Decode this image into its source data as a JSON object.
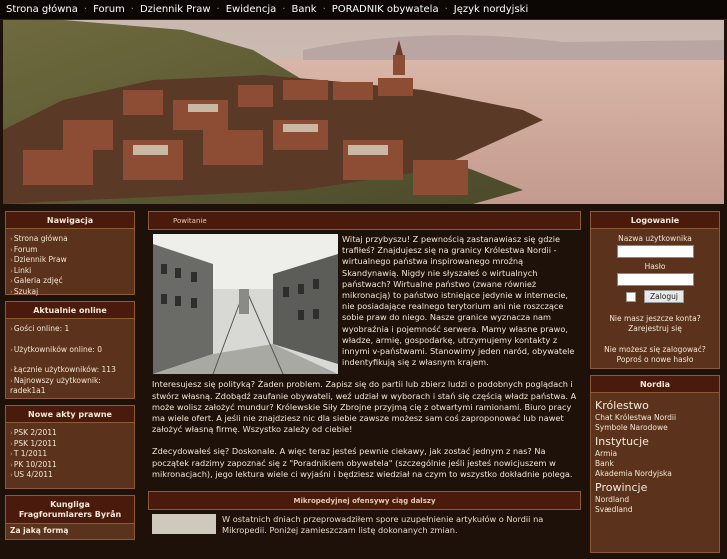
{
  "topnav": [
    "Strona główna",
    "Forum",
    "Dziennik Praw",
    "Ewidencja",
    "Bank",
    "PORADNIK obywatela",
    "Język nordyjski"
  ],
  "left": {
    "nav": {
      "title": "Nawigacja",
      "items": [
        "Strona główna",
        "Forum",
        "Dziennik Praw",
        "Linki",
        "Galeria zdjęć",
        "Szukaj"
      ]
    },
    "online": {
      "title": "Aktualnie online",
      "guests": "Gości online: 1",
      "users": "Użytkowników online: 0",
      "total": "Łącznie użytkowników: 113",
      "newest_label": "Najnowszy użytkownik:",
      "newest_user": "radek1a1"
    },
    "acts": {
      "title": "Nowe akty prawne",
      "items": [
        "PSK 2/2011",
        "PSK 1/2011",
        "T 1/2011",
        "PK 10/2011",
        "US 4/2011"
      ]
    },
    "kungliga": {
      "title_line1": "Kungliga",
      "title_line2": "Fragforumlarers Byrån",
      "body": "Za jaką formą"
    }
  },
  "center": {
    "welcome_title": "Powitanie",
    "paragraph1": "Witaj przybyszu! Z pewnością zastanawiasz się gdzie trafiłeś? Znajdujesz się na granicy Królestwa Nordii - wirtualnego państwa inspirowanego mroźną Skandynawią. Nigdy nie słyszałeś o wirtualnych państwach? Wirtualne państwo (zwane również mikronacją) to państwo istniejące jedynie w internecie, nie posiadające realnego terytorium ani nie roszczące sobie praw do niego. Nasze granice wyznacza nam wyobraźnia i pojemność serwera. Mamy własne prawo, władze, armię, gospodarkę, utrzymujemy kontakty z innymi v-państwami. Stanowimy jeden naród, obywatele indentyfikują się z własnym krajem.",
    "paragraph2": "Interesujesz się polityką? Żaden problem. Zapisz się do partii lub zbierz ludzi o podobnych poglądach i stwórz własną. Zdobądź zaufanie obywateli, weź udział w wyborach i stań się częścią władz państwa. A może wolisz założyć mundur? Królewskie Siły Zbrojne przyjmą cię z otwartymi ramionami. Biuro pracy ma wiele ofert. A jeśli nie znajdziesz nic dla siebie zawsze możesz sam coś zaproponować lub nawet założyć własną firmę. Wszystko zależy od ciebie!",
    "paragraph3": "Zdecydowałeś się? Doskonale. A więc teraz jesteś pewnie ciekawy, jak zostać jednym z nas? Na początek radzimy zapoznać się z \"Poradnikiem obywatela\" (szczególnie jeśli jesteś nowicjuszem w mikronacjach), jego lektura wiele ci wyjaśni i będziesz wiedział na czym to wszystko dokładnie polega.",
    "news_title": "Mikropedyjnej ofensywy ciąg dalszy",
    "news_text": "W ostatnich dniach przeprowadziłem spore uzupełnienie artykułów o Nordii na Mikropedii. Poniżej zamieszczam listę dokonanych zmian."
  },
  "right": {
    "login": {
      "title": "Logowanie",
      "username_label": "Nazwa użytkownika",
      "password_label": "Hasło",
      "button": "Zaloguj",
      "no_account": "Nie masz jeszcze konta?",
      "register": "Zarejestruj się",
      "forgot": "Nie możesz się zalogować?",
      "reset": "Poproś o nowe hasło"
    },
    "nordia": {
      "title": "Nordia",
      "groups": [
        {
          "name": "Królestwo",
          "items": [
            "Chat Królestwa Nordii",
            "Symbole Narodowe"
          ]
        },
        {
          "name": "Instytucje",
          "items": [
            "Armia",
            "Bank",
            "Akademia Nordyjska"
          ]
        },
        {
          "name": "Prowincje",
          "items": [
            "Nordland",
            "Svædland"
          ]
        }
      ]
    }
  }
}
